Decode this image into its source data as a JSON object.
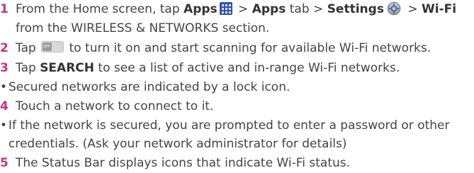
{
  "steps": [
    {
      "number": "1",
      "pre": "From the Home screen, tap ",
      "apps_bold": "Apps",
      "sep1": " > ",
      "apps_tab_bold": "Apps",
      "tab_text": " tab > ",
      "settings_bold": "Settings",
      "sep2": " > ",
      "wifi_bold": "Wi-Fi",
      "line2": "from the WIRELESS & NETWORKS section."
    },
    {
      "number": "2",
      "pre": "Tap ",
      "post": " to turn it on and start scanning for available Wi-Fi networks."
    },
    {
      "number": "3",
      "pre": "Tap ",
      "search_bold": "SEARCH",
      "post": " to see a list of active and in-range Wi-Fi networks."
    },
    {
      "number": "4",
      "text": "Touch a network to connect to it."
    },
    {
      "number": "5",
      "text": "The Status Bar displays icons that indicate Wi-Fi status."
    }
  ],
  "bullets": [
    {
      "symbol": "•",
      "text": "Secured networks are indicated by a lock icon."
    },
    {
      "symbol": "•",
      "line1": "If the network is secured, you are prompted to enter a password or other",
      "line2": "credentials. (Ask your network administrator for details)"
    }
  ],
  "icons": {
    "apps": "apps-grid-icon",
    "settings": "settings-gear-icon",
    "toggle": "off-toggle-icon",
    "toggle_label": "OFF"
  },
  "colors": {
    "step_number": "#c7327e",
    "text": "#444444",
    "apps_icon": "#2f4fb3"
  }
}
